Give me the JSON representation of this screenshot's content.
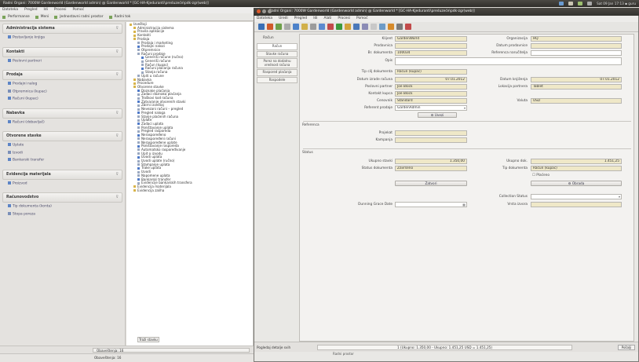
{
  "top_panel": {
    "title": "Radni Organi: 7000W Gardenworld (Gardenworld admin) @ Gardenworld * [GC-HA-Kjeduranti\\preduzeće\\pdk-zgr(web)]",
    "tray": "Sat 09 Jan 17:13  ▪ guru"
  },
  "main": {
    "menu": [
      "Datoteka",
      "Pregled",
      "Idi",
      "Procesi",
      "Pomoć"
    ],
    "toolbar": [
      "Performanse",
      "Meni",
      "Jednostavni radni prostor",
      "Radni tok"
    ],
    "sidebar": [
      {
        "title": "Administracija sistema",
        "items": [
          "Postavljanje knjiga"
        ]
      },
      {
        "title": "Kontakti",
        "items": [
          "Poslovni partneri"
        ]
      },
      {
        "title": "Prodaja",
        "items": [
          "Prodajni nalog",
          "Otpremnica (kupac)",
          "Računi (kupac)"
        ]
      },
      {
        "title": "Nabavka",
        "items": [
          "Računi (dobavljač)"
        ]
      },
      {
        "title": "Otvorene stavke",
        "items": [
          "Uplate",
          "Izvodi",
          "Bankarski transfer"
        ]
      },
      {
        "title": "Evidencija materijala",
        "items": [
          "Proizvod"
        ]
      },
      {
        "title": "Računovodstvo",
        "items": [
          "Tip dokumenta (konta)",
          "Stopa poreza"
        ]
      }
    ],
    "tree": [
      "Izveštaji",
      "Administracija sistema",
      "Pravila aplikacije",
      "Kontakti",
      "Prodaja",
      "Prodaja i marketing",
      "Prodajni nalozi",
      "Otpremnice",
      "Računi prodaje",
      "Generiši račune (ručno)",
      "Generiši račune",
      "Račun (kupac)",
      "Računi plaćanja računa",
      "Stanja računa",
      "Upiti u račune",
      "Nabavka",
      "Procedure",
      "Otvorene stavke",
      "Doznake plaćanja",
      "Zadaci doznaka plaćanja",
      "Troškovi kod računa",
      "Zatvaranje otvorenih stavki",
      "Zbirni izveštaj",
      "Nevezani računi – pregled",
      "Pregled naloga",
      "Stanje plaćenih računa",
      "Uplate",
      "Zadaci uplata",
      "Poništavanje uplata",
      "Pregled rasporeda",
      "Neraspoređeno",
      "Neraspoređeni računi",
      "Neraspoređene uplate",
      "Poništavanje rasporeda",
      "Automatsko raspoređivanje",
      "Upit o izvodu",
      "Izvodi uplata",
      "Izvodi uplate (ručno)",
      "Štampanje uplata",
      "Trake uplata",
      "Izvodi",
      "Napomene uplata",
      "Bankarski transfer",
      "Evidencije bankarskih transfera",
      "Evidencija materijala",
      "Evidencija zaliha"
    ],
    "tree_button": "Traži stavku",
    "status": "Obaveštenja: 16"
  },
  "win2": {
    "title": "Radni Organi: 7000W Gardenworld (Gardenworld admin) @ Gardenworld * [GC-HA-Kjeduranti\\preduzeće\\pdk-zgr(web)]",
    "menu": [
      "Datoteka",
      "Uredi",
      "Pregled",
      "Idi",
      "Alati",
      "Procesi",
      "Pomoć"
    ],
    "tabs": [
      "Račun",
      "Stavke računa",
      "Porez na dodatnu vrednost računa",
      "Raspored plaćanja",
      "Raspodele"
    ],
    "tab_header": "Račun",
    "fields": {
      "klijent_label": "Klijent",
      "klijent": "GardenWorld",
      "organizacija_label": "Organizacija",
      "organizacija": "HQ",
      "prodavnica_label": "Prodavnica",
      "prodavnica": "",
      "datum_prod_label": "Datum prodavnice",
      "datum_prod": "",
      "brdok_label": "Br. dokumenta",
      "brdok": "100034",
      "ref_label": "Referenca naručitelja",
      "ref": "",
      "opis_label": "Opis",
      "opis": "",
      "tipcilj_label": "Tip cilj dokumenta",
      "tipcilj": "Račun (kupac)",
      "datum_label": "Datum izrade računa",
      "datum": "07.01.2012",
      "datum_knj_label": "Datum knjiženja",
      "datum_knj": "07.01.2012",
      "partner_label": "Poslovni partner",
      "partner": "Joe Block",
      "lok_label": "Lokacija partnera",
      "lok": "Tablet",
      "kontakt_label": "Kontakt kupca",
      "kontakt": "Joe Block",
      "cenovnik_label": "Cenovnik",
      "cenovnik": "Standard",
      "valuta_label": "Valuta",
      "valuta": "USD",
      "prodavac_label": "Referent prodaje",
      "prodavac": "GardenAdmin",
      "usluge_btn": "Uvezi"
    },
    "ref_section": "Referenca",
    "projekat_label": "Projekat",
    "projekat": "",
    "kampanja_label": "Kampanja",
    "kampanja": "",
    "status_section": "Status",
    "ukupno_label": "Ukupno stavki",
    "ukupno": "1.350,00",
    "ukupno2_label": "Ukupno dok.",
    "ukupno2": "1.451,25",
    "statusdok_label": "Status dokumenta",
    "statusdok": "Završeno",
    "tipdok_label": "Tip dokumenta",
    "tipdok": "Račun (kupac)",
    "placeno": "Plaćeno",
    "zatvori_btn": "Zatvori",
    "obradi_btn": "Obrada",
    "collection_label": "Collection Status",
    "collection": "",
    "dunning_label": "Dunning Grace Date",
    "dunning": "",
    "izvor_label": "Vrsta izvora",
    "izvor": "",
    "status_box": "1 (Ukupno: 1.350,00 - Ukupno: 1.451,25 USD = 1.451,25)",
    "status_left": "Pogledaj detalje svih",
    "status_right": "Pošalji",
    "below": "Radni prostor"
  }
}
